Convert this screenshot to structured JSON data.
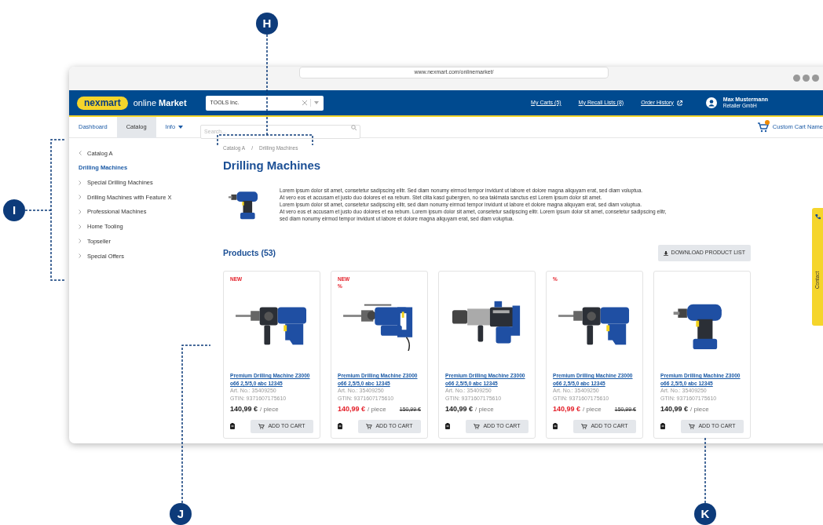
{
  "browser": {
    "url": "www.nexmart.com/onlinemarket/"
  },
  "header": {
    "logo": "nexmart",
    "app_name": "online **Market**",
    "company_select": {
      "value": "TOOLS Inc."
    },
    "links": [
      {
        "label": "My Carts (5)",
        "external": false
      },
      {
        "label": "My Recall Lists (8)",
        "external": false
      },
      {
        "label": "Order History",
        "external": true
      }
    ],
    "user": {
      "name": "Max Mustermann",
      "company": "Retailer GmbH"
    }
  },
  "tabs": [
    {
      "label": "Dashboard",
      "selected": false,
      "dropdown": false
    },
    {
      "label": "Catalog",
      "selected": true,
      "dropdown": false
    },
    {
      "label": "Info",
      "selected": false,
      "dropdown": true
    }
  ],
  "search": {
    "placeholder": "Search..."
  },
  "cart": {
    "label": "Custom Cart Name"
  },
  "sidebar": {
    "items": [
      {
        "label": "Catalog A",
        "kind": "back"
      },
      {
        "label": "Drilling Machines",
        "kind": "current"
      },
      {
        "label": "Special Drilling Machines",
        "kind": "child"
      },
      {
        "label": "Drilling Machines with Feature X",
        "kind": "child"
      },
      {
        "label": "Professional Machines",
        "kind": "child"
      },
      {
        "label": "Home Tooling",
        "kind": "child"
      },
      {
        "label": "Topseller",
        "kind": "child"
      },
      {
        "label": "Special Offers",
        "kind": "child"
      }
    ]
  },
  "breadcrumb": [
    {
      "label": "Catalog A"
    },
    {
      "label": "Drilling Machines"
    }
  ],
  "breadcrumb_separator": "/",
  "title": "Drilling Machines",
  "description": [
    "Lorem ipsum dolor sit amet, consetetur sadipscing elitr. Sed diam nonumy eirmod tempor invidunt ut labore et dolore magna aliquyam erat, sed diam voluptua.",
    "At vero eos et accusam et justo duo dolores et ea rebum. Stet clita kasd gubergren, no sea takimata sanctus est Lorem ipsum dolor sit amet.",
    "Lorem ipsum dolor sit amet, consetetur sadipscing elitr, sed diam nonumy eirmod tempor invidunt ut labore et dolore magna aliquyam erat, sed diam voluptua.",
    "At vero eos et accusam et justo duo dolores et ea rebum. Lorem ipsum dolor sit amet, consetetur sadipscing elitr. Lorem ipsum dolor sit amet, consetetur sadipscing elitr,",
    "sed diam nonumy eirmod tempor invidunt ut labore et dolore magna aliquyam erat, sed diam voluptua."
  ],
  "products_heading": "Products (53)",
  "download_button": "DOWNLOAD PRODUCT LIST",
  "products": [
    {
      "badges": [
        "NEW"
      ],
      "kind": "hammer-drill",
      "name": "Premium Drilling Machine Z3000 o66 2,5/5,0 abc 12345",
      "art_no": "Art. No.: 35409250",
      "gtin": "GTIN: 9371607175610",
      "price": "140,99 €",
      "unit": "/ piece",
      "on_sale": false,
      "button": "ADD TO CART"
    },
    {
      "badges": [
        "NEW",
        "%"
      ],
      "kind": "rotary-hammer",
      "name": "Premium Drilling Machine Z3000 o66 2,5/5,0 abc 12345",
      "art_no": "Art. No.: 35409250",
      "gtin": "GTIN: 9371607175610",
      "price": "140,99 €",
      "unit": "/ piece",
      "on_sale": true,
      "old_price": "150,99 €",
      "button": "ADD TO CART"
    },
    {
      "kind": "demolition-hammer",
      "name": "Premium Drilling Machine Z3000 o66 2,5/5,0 abc 12345",
      "art_no": "Art. No.: 35409250",
      "gtin": "GTIN: 9371607175610",
      "price": "140,99 €",
      "unit": "/ piece",
      "on_sale": false,
      "button": "ADD TO CART"
    },
    {
      "badges": [
        "%"
      ],
      "kind": "hammer-drill",
      "name": "Premium Drilling Machine Z3000 o66 2,5/5,0 abc 12345",
      "art_no": "Art. No.: 35409250",
      "gtin": "GTIN: 9371607175610",
      "price": "140,99 €",
      "unit": "/ piece",
      "on_sale": true,
      "old_price": "150,99 €",
      "button": "ADD TO CART"
    },
    {
      "kind": "cordless-drill",
      "name": "Premium Drilling Machine Z3000 o66 2,5/5,0 abc 12345",
      "art_no": "Art. No.: 35409250",
      "gtin": "GTIN: 9371607175610",
      "price": "140,99 €",
      "unit": "/ piece",
      "on_sale": false,
      "button": "ADD TO CART"
    }
  ],
  "contact_tab": {
    "label": "Contact"
  },
  "callouts": [
    {
      "label": "H"
    },
    {
      "label": "I"
    },
    {
      "label": "J"
    },
    {
      "label": "K"
    }
  ]
}
